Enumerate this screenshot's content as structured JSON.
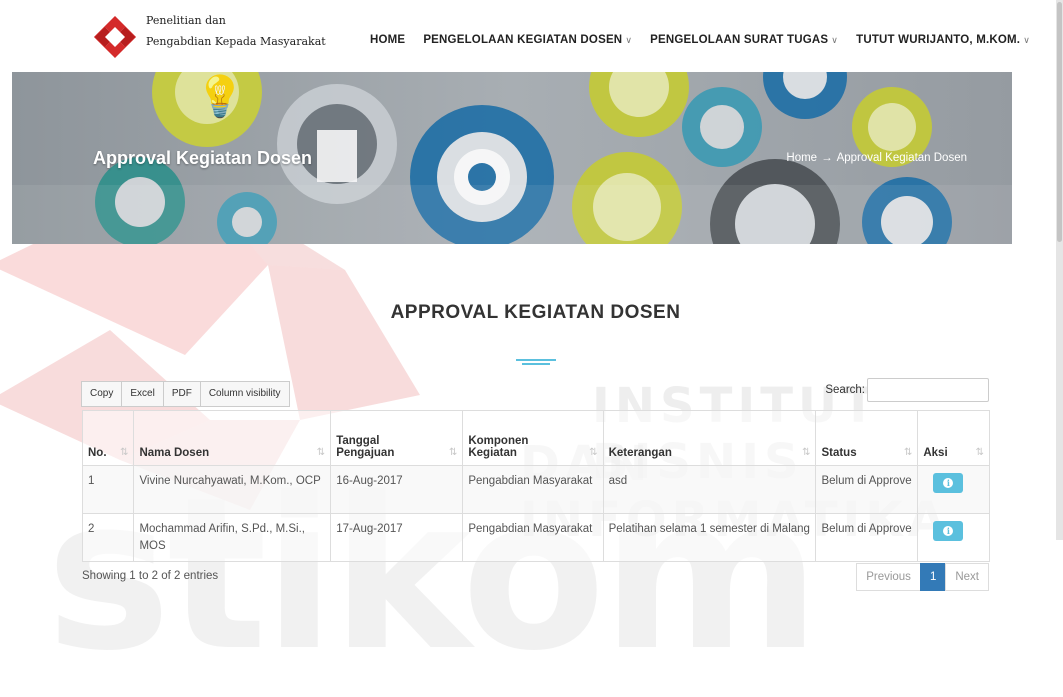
{
  "brand": {
    "line1": "Penelitian dan",
    "line2": "Pengabdian Kepada Masyarakat"
  },
  "nav": [
    {
      "label": "HOME",
      "dropdown": false
    },
    {
      "label": "PENGELOLAAN KEGIATAN DOSEN",
      "dropdown": true
    },
    {
      "label": "PENGELOLAAN SURAT TUGAS",
      "dropdown": true
    },
    {
      "label": "TUTUT WURIJANTO, M.KOM.",
      "dropdown": true
    }
  ],
  "banner": {
    "title": "Approval Kegiatan Dosen",
    "breadcrumb_home": "Home",
    "breadcrumb_arrow": "→",
    "breadcrumb_current": "Approval Kegiatan Dosen"
  },
  "section": {
    "title": "APPROVAL KEGIATAN DOSEN"
  },
  "toolbar": {
    "copy": "Copy",
    "excel": "Excel",
    "pdf": "PDF",
    "colvis": "Column visibility",
    "search_label": "Search:",
    "search_value": ""
  },
  "table": {
    "headers": [
      "No.",
      "Nama Dosen",
      "Tanggal Pengajuan",
      "Komponen Kegiatan",
      "Keterangan",
      "Status",
      "Aksi"
    ],
    "rows": [
      {
        "no": "1",
        "nama": "Vivine Nurcahyawati, M.Kom., OCP",
        "tanggal": "16-Aug-2017",
        "komponen": "Pengabdian Masyarakat",
        "keterangan": "asd",
        "status": "Belum di Approve"
      },
      {
        "no": "2",
        "nama": "Mochammad Arifin, S.Pd., M.Si., MOS",
        "tanggal": "17-Aug-2017",
        "komponen": "Pengabdian Masyarakat",
        "keterangan": "Pelatihan selama 1 semester di Malang",
        "status": "Belum di Approve"
      }
    ]
  },
  "footer": {
    "info": "Showing 1 to 2 of 2 entries",
    "previous": "Previous",
    "page": "1",
    "next": "Next"
  },
  "watermark": {
    "text1": "INSTITUT BISNIS",
    "text2": "DAN INFORMATIKA",
    "text3": "stikom"
  },
  "colors": {
    "accent": "#5bc0de",
    "pager_active": "#337ab7",
    "logo_red": "#d42a2a"
  }
}
